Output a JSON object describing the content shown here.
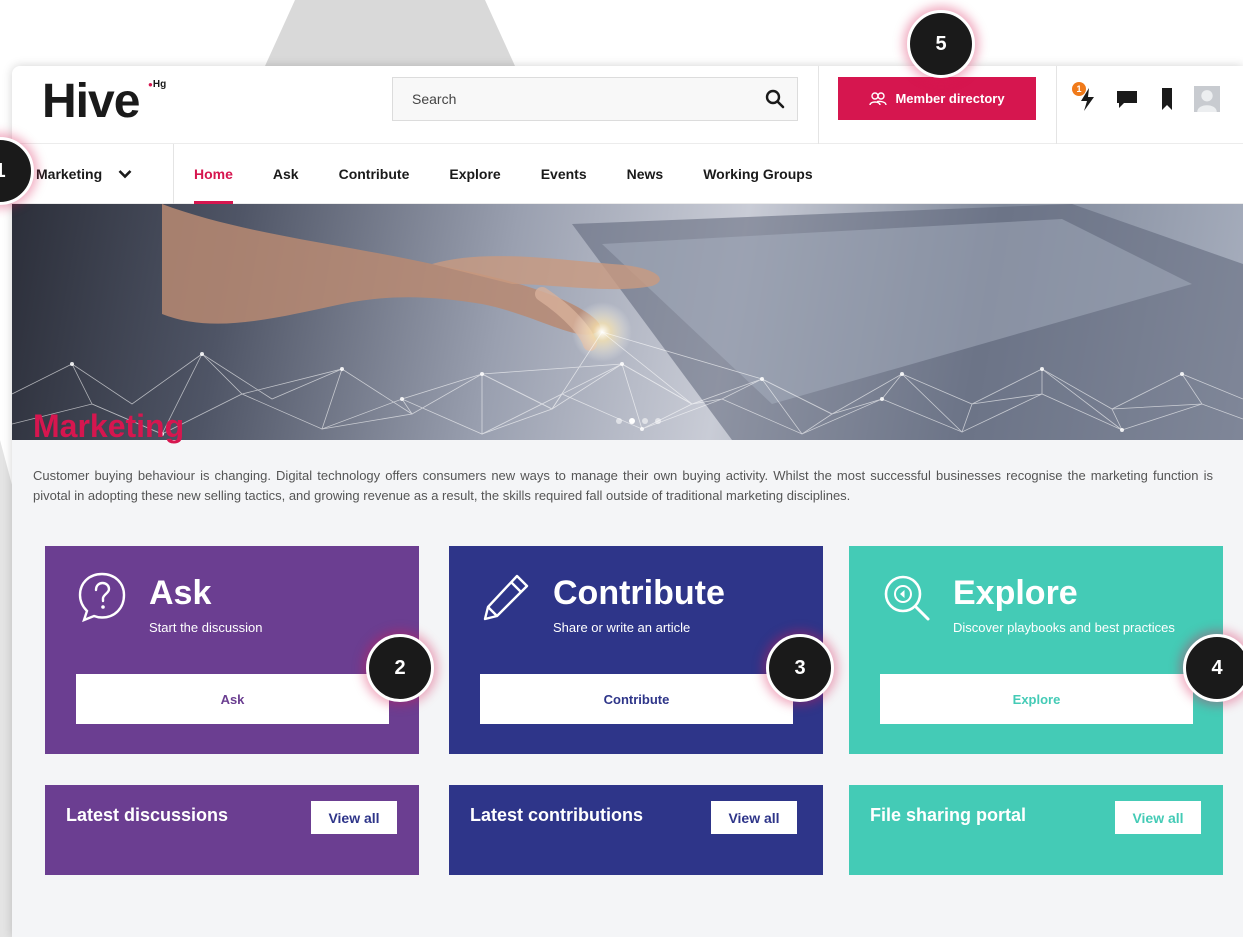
{
  "header": {
    "logo": "Hive",
    "logo_sup": "Hg",
    "search_placeholder": "Search",
    "member_directory_label": "Member directory",
    "notification_count": "1"
  },
  "nav": {
    "community_label": "Marketing",
    "items": [
      {
        "label": "Home",
        "active": true
      },
      {
        "label": "Ask"
      },
      {
        "label": "Contribute"
      },
      {
        "label": "Explore"
      },
      {
        "label": "Events"
      },
      {
        "label": "News"
      },
      {
        "label": "Working Groups"
      }
    ]
  },
  "main": {
    "title": "Marketing",
    "description": "Customer buying behaviour is changing.  Digital technology offers consumers new ways to manage their own buying activity. Whilst the most successful businesses recognise the marketing function is pivotal in adopting these new selling tactics, and growing revenue as a result, the skills required fall outside of traditional marketing disciplines.",
    "cards": [
      {
        "title": "Ask",
        "subtitle": "Start the discussion",
        "button": "Ask",
        "color": "#6b3e91",
        "icon": "question-bubble-icon"
      },
      {
        "title": "Contribute",
        "subtitle": "Share or write an article",
        "button": "Contribute",
        "color": "#2e3589",
        "icon": "pencil-icon"
      },
      {
        "title": "Explore",
        "subtitle": "Discover playbooks and best practices",
        "button": "Explore",
        "color": "#44cbb6",
        "icon": "magnifier-icon"
      }
    ],
    "latest": [
      {
        "title": "Latest discussions",
        "button": "View all"
      },
      {
        "title": "Latest contributions",
        "button": "View all"
      },
      {
        "title": "File sharing portal",
        "button": "View all"
      }
    ]
  },
  "callouts": [
    "1",
    "2",
    "3",
    "4",
    "5"
  ],
  "colors": {
    "accent": "#d6164f",
    "ask_purple": "#6b3e91",
    "contribute_blue": "#2e3589",
    "explore_teal": "#44cbb6"
  }
}
